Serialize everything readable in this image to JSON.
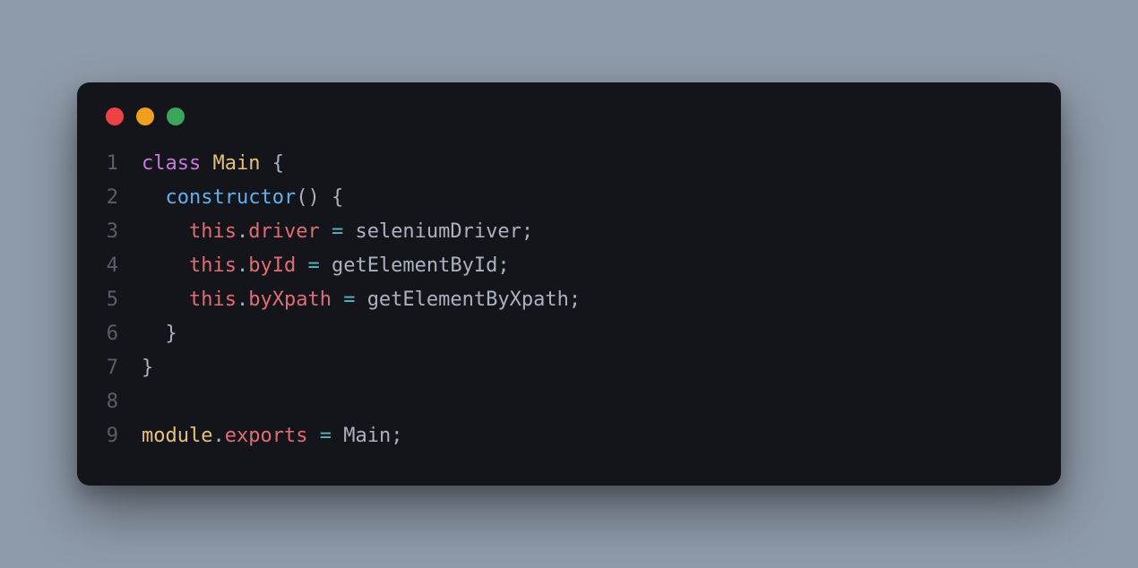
{
  "traffic_lights": {
    "red": "#ed4245",
    "yellow": "#f0a020",
    "green": "#3ba55c"
  },
  "code": {
    "lines": [
      {
        "num": "1",
        "tokens": [
          {
            "cls": "kw",
            "t": "class"
          },
          {
            "cls": "",
            "t": " "
          },
          {
            "cls": "cls",
            "t": "Main"
          },
          {
            "cls": "",
            "t": " "
          },
          {
            "cls": "brace",
            "t": "{"
          }
        ]
      },
      {
        "num": "2",
        "tokens": [
          {
            "cls": "",
            "t": "  "
          },
          {
            "cls": "fn",
            "t": "constructor"
          },
          {
            "cls": "punct",
            "t": "()"
          },
          {
            "cls": "",
            "t": " "
          },
          {
            "cls": "brace",
            "t": "{"
          }
        ]
      },
      {
        "num": "3",
        "tokens": [
          {
            "cls": "",
            "t": "    "
          },
          {
            "cls": "this",
            "t": "this"
          },
          {
            "cls": "dot",
            "t": "."
          },
          {
            "cls": "prop",
            "t": "driver"
          },
          {
            "cls": "",
            "t": " "
          },
          {
            "cls": "op",
            "t": "="
          },
          {
            "cls": "",
            "t": " "
          },
          {
            "cls": "ident",
            "t": "seleniumDriver"
          },
          {
            "cls": "punct",
            "t": ";"
          }
        ]
      },
      {
        "num": "4",
        "tokens": [
          {
            "cls": "",
            "t": "    "
          },
          {
            "cls": "this",
            "t": "this"
          },
          {
            "cls": "dot",
            "t": "."
          },
          {
            "cls": "prop",
            "t": "byId"
          },
          {
            "cls": "",
            "t": " "
          },
          {
            "cls": "op",
            "t": "="
          },
          {
            "cls": "",
            "t": " "
          },
          {
            "cls": "ident",
            "t": "getElementById"
          },
          {
            "cls": "punct",
            "t": ";"
          }
        ]
      },
      {
        "num": "5",
        "tokens": [
          {
            "cls": "",
            "t": "    "
          },
          {
            "cls": "this",
            "t": "this"
          },
          {
            "cls": "dot",
            "t": "."
          },
          {
            "cls": "prop",
            "t": "byXpath"
          },
          {
            "cls": "",
            "t": " "
          },
          {
            "cls": "op",
            "t": "="
          },
          {
            "cls": "",
            "t": " "
          },
          {
            "cls": "ident",
            "t": "getElementByXpath"
          },
          {
            "cls": "punct",
            "t": ";"
          }
        ]
      },
      {
        "num": "6",
        "tokens": [
          {
            "cls": "",
            "t": "  "
          },
          {
            "cls": "brace",
            "t": "}"
          }
        ]
      },
      {
        "num": "7",
        "tokens": [
          {
            "cls": "brace",
            "t": "}"
          }
        ]
      },
      {
        "num": "8",
        "tokens": [
          {
            "cls": "",
            "t": ""
          }
        ]
      },
      {
        "num": "9",
        "tokens": [
          {
            "cls": "mod",
            "t": "module"
          },
          {
            "cls": "dot",
            "t": "."
          },
          {
            "cls": "prop",
            "t": "exports"
          },
          {
            "cls": "",
            "t": " "
          },
          {
            "cls": "op",
            "t": "="
          },
          {
            "cls": "",
            "t": " "
          },
          {
            "cls": "ident",
            "t": "Main"
          },
          {
            "cls": "punct",
            "t": ";"
          }
        ]
      }
    ]
  }
}
